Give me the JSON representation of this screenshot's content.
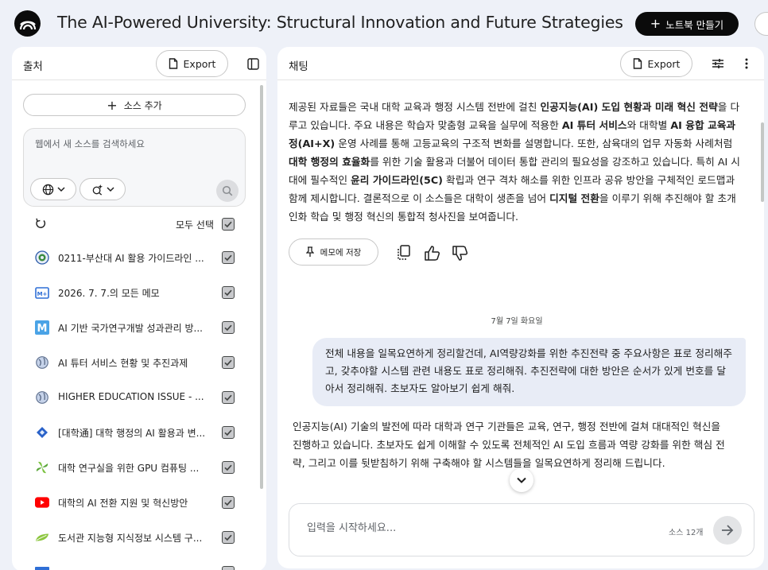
{
  "header": {
    "title": "The AI-Powered University: Structural Innovation and Future Strategies",
    "new_notebook_label": "노트북 만들기"
  },
  "sources_panel": {
    "title": "출처",
    "export_label": "Export",
    "add_source_label": "소스 추가",
    "search_placeholder": "웹에서 새 소스를 검색하세요",
    "select_all_label": "모두 선택",
    "items": [
      {
        "title": "0211-부산대 AI 활용 가이드라인 ...",
        "icon": "university-seal-icon",
        "checked": true
      },
      {
        "title": "2026. 7. 7.의 모든 메모",
        "icon": "memo-icon",
        "checked": true
      },
      {
        "title": "AI 기반 국가연구개발 성과관리 방...",
        "icon": "m-logo-icon",
        "checked": true
      },
      {
        "title": "AI 튜터 서비스 현황 및 추진과제",
        "icon": "globe-icon",
        "checked": true
      },
      {
        "title": "HIGHER EDUCATION ISSUE - ...",
        "icon": "globe-icon",
        "checked": true
      },
      {
        "title": "[대학通] 대학 행정의 AI 활용과 변...",
        "icon": "diamond-icon",
        "checked": true
      },
      {
        "title": "대학 연구실을 위한 GPU 컴퓨팅 ...",
        "icon": "pinwheel-icon",
        "checked": true
      },
      {
        "title": "대학의 AI 전환 지원 및 혁신방안",
        "icon": "youtube-icon",
        "checked": true
      },
      {
        "title": "도서관 지능형 지식정보 시스템 구...",
        "icon": "leaf-icon",
        "checked": true
      }
    ]
  },
  "chat_panel": {
    "title": "채팅",
    "export_label": "Export",
    "summary_segments": [
      {
        "text": "제공된 자료들은 국내 대학 교육과 행정 시스템 전반에 걸친 ",
        "bold": false
      },
      {
        "text": "인공지능(AI) 도입 현황과 미래 혁신 전략",
        "bold": true
      },
      {
        "text": "을 다루고 있습니다. 주요 내용은 학습자 맞춤형 교육을 실무에 적용한 ",
        "bold": false
      },
      {
        "text": "AI 튜터 서비스",
        "bold": true
      },
      {
        "text": "와 대학별 ",
        "bold": false
      },
      {
        "text": "AI 융합 교육과정(AI+X)",
        "bold": true
      },
      {
        "text": " 운영 사례를 통해 고등교육의 구조적 변화를 설명합니다. 또한, 삼육대의 업무 자동화 사례처럼 ",
        "bold": false
      },
      {
        "text": "대학 행정의 효율화",
        "bold": true
      },
      {
        "text": "를 위한 기술 활용과 더불어 데이터 통합 관리의 필요성을 강조하고 있습니다. 특히 AI 시대에 필수적인 ",
        "bold": false
      },
      {
        "text": "윤리 가이드라인(5C)",
        "bold": true
      },
      {
        "text": " 확립과 연구 격차 해소를 위한 인프라 공유 방안을 구체적인 로드맵과 함께 제시합니다. 결론적으로 이 소스들은 대학이 생존을 넘어 ",
        "bold": false
      },
      {
        "text": "디지털 전환",
        "bold": true
      },
      {
        "text": "을 이루기 위해 추진해야 할 초개인화 학습 및 행정 혁신의 통합적 청사진을 보여줍니다.",
        "bold": false
      }
    ],
    "save_note_label": "메모에 저장",
    "date_label": "7월 7일 화요일",
    "user_message": "전체 내용을 일목요연하게 정리할건데, AI역량강화를 위한 추진전략 중 주요사항은 표로 정리해주고, 갖추야할 시스템 관련 내용도 표로 정리해줘. 추진전략에 대한 방안은 순서가 있게 번호를 달아서 정리해줘. 초보자도 알아보기 쉽게 해줘.",
    "answer": "인공지능(AI) 기술의 발전에 따라 대학과 연구 기관들은 교육, 연구, 행정 전반에 걸쳐 대대적인 혁신을 진행하고 있습니다. 초보자도 쉽게 이해할 수 있도록 전체적인 AI 도입 흐름과 역량 강화를 위한 핵심 전략, 그리고 이를 뒷받침하기 위해 구축해야 할 시스템들을 일목요연하게 정리해 드립니다.",
    "composer_placeholder": "입력을 시작하세요...",
    "source_count": "소스 12개"
  },
  "colors": {
    "page_bg": "#eef1f8",
    "panel_bg": "#ffffff",
    "user_bubble": "#e8ecf6",
    "primary_button": "#0b0b0b"
  }
}
